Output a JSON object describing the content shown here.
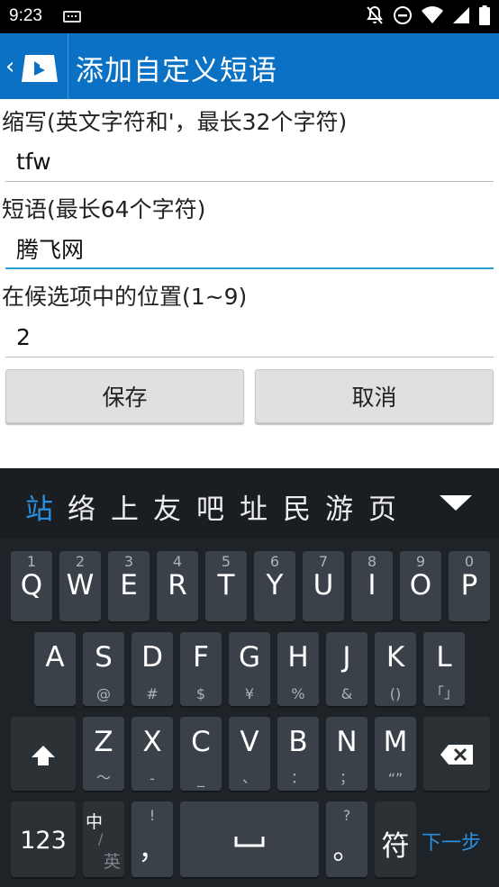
{
  "status_bar": {
    "time": "9:23",
    "icons": [
      "keyboard-icon",
      "notifications-off-icon",
      "do-not-disturb-icon",
      "wifi-icon",
      "signal-icon",
      "battery-icon"
    ]
  },
  "app_bar": {
    "back_glyph": "‹",
    "title": "添加自定义短语",
    "color": "#0a71c4"
  },
  "form": {
    "abbr_label": "缩写(英文字符和'，最长32个字符)",
    "abbr_value": "tfw",
    "phrase_label": "短语(最长64个字符)",
    "phrase_value": "腾飞网",
    "position_label": "在候选项中的位置(1~9)",
    "position_value": "2",
    "save_label": "保存",
    "cancel_label": "取消"
  },
  "keyboard": {
    "candidates": [
      "站",
      "络",
      "上",
      "友",
      "吧",
      "址",
      "民",
      "游",
      "页"
    ],
    "row1": [
      {
        "num": "1",
        "letter": "Q"
      },
      {
        "num": "2",
        "letter": "W"
      },
      {
        "num": "3",
        "letter": "E"
      },
      {
        "num": "4",
        "letter": "R"
      },
      {
        "num": "5",
        "letter": "T"
      },
      {
        "num": "6",
        "letter": "Y"
      },
      {
        "num": "7",
        "letter": "U"
      },
      {
        "num": "8",
        "letter": "I"
      },
      {
        "num": "9",
        "letter": "O"
      },
      {
        "num": "0",
        "letter": "P"
      }
    ],
    "row2": [
      {
        "letter": "A",
        "sym": ""
      },
      {
        "letter": "S",
        "sym": "@"
      },
      {
        "letter": "D",
        "sym": "#"
      },
      {
        "letter": "F",
        "sym": "$"
      },
      {
        "letter": "G",
        "sym": "¥"
      },
      {
        "letter": "H",
        "sym": "%"
      },
      {
        "letter": "J",
        "sym": "&"
      },
      {
        "letter": "K",
        "sym": "()"
      },
      {
        "letter": "L",
        "sym": "「」"
      }
    ],
    "row3": [
      {
        "letter": "Z",
        "sym": "～"
      },
      {
        "letter": "X",
        "sym": "-"
      },
      {
        "letter": "C",
        "sym": "_"
      },
      {
        "letter": "V",
        "sym": "、"
      },
      {
        "letter": "B",
        "sym": "："
      },
      {
        "letter": "N",
        "sym": "；"
      },
      {
        "letter": "M",
        "sym": "“”"
      }
    ],
    "num_key": "123",
    "lang_top": "中",
    "lang_bottom": "英",
    "comma_hint": "!",
    "comma": "，",
    "period_hint": "?",
    "period": "。",
    "symbol_key": "符",
    "next_label": "下一步",
    "accent": "#2a8fe0"
  }
}
